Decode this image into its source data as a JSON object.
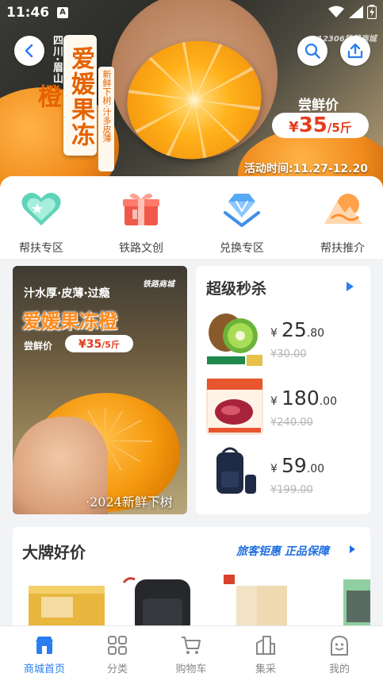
{
  "status_bar": {
    "time": "11:46",
    "a_indicator": "A"
  },
  "hero": {
    "origin_text": "四川·眉山",
    "title": "爱媛果冻橙",
    "subtitle": "新鲜下树·汁多皮薄",
    "brand_watermark": "12306铁路商城",
    "price_label": "尝鲜价",
    "price_currency": "¥",
    "price_value": "35",
    "price_unit": "/5斤",
    "activity_time": "活动时间:11.27-12.20"
  },
  "categories": [
    {
      "label": "帮扶专区",
      "icon": "heart-shield-icon"
    },
    {
      "label": "铁路文创",
      "icon": "gift-box-icon"
    },
    {
      "label": "兑换专区",
      "icon": "diamond-exchange-icon"
    },
    {
      "label": "帮扶推介",
      "icon": "mountain-sun-icon"
    }
  ],
  "promo_banner": {
    "line1": "汁水厚·皮薄·过瘾",
    "brand": "铁路商城",
    "title": "爱媛果冻橙",
    "price_label": "尝鲜价",
    "price": "¥35",
    "unit": "/5斤",
    "tagline": "·2024新鲜下树"
  },
  "flash_sale": {
    "title": "超级秒杀",
    "items": [
      {
        "name": "kiwi",
        "currency": "¥",
        "price_int": "25",
        "price_dec": ".80",
        "original_price": "¥30.00"
      },
      {
        "name": "beef",
        "currency": "¥",
        "price_int": "180",
        "price_dec": ".00",
        "original_price": "¥240.00"
      },
      {
        "name": "backpack",
        "currency": "¥",
        "price_int": "59",
        "price_dec": ".00",
        "original_price": "¥199.00"
      }
    ]
  },
  "brand_section": {
    "title": "大牌好价",
    "slogan": "旅客钜惠 正品保障"
  },
  "bottom_nav": [
    {
      "label": "商城首页",
      "active": true
    },
    {
      "label": "分类",
      "active": false
    },
    {
      "label": "购物车",
      "active": false
    },
    {
      "label": "集采",
      "active": false
    },
    {
      "label": "我的",
      "active": false
    }
  ],
  "colors": {
    "accent_blue": "#2a7ef0",
    "price_red": "#e33c1c",
    "orange": "#f08a1c"
  }
}
